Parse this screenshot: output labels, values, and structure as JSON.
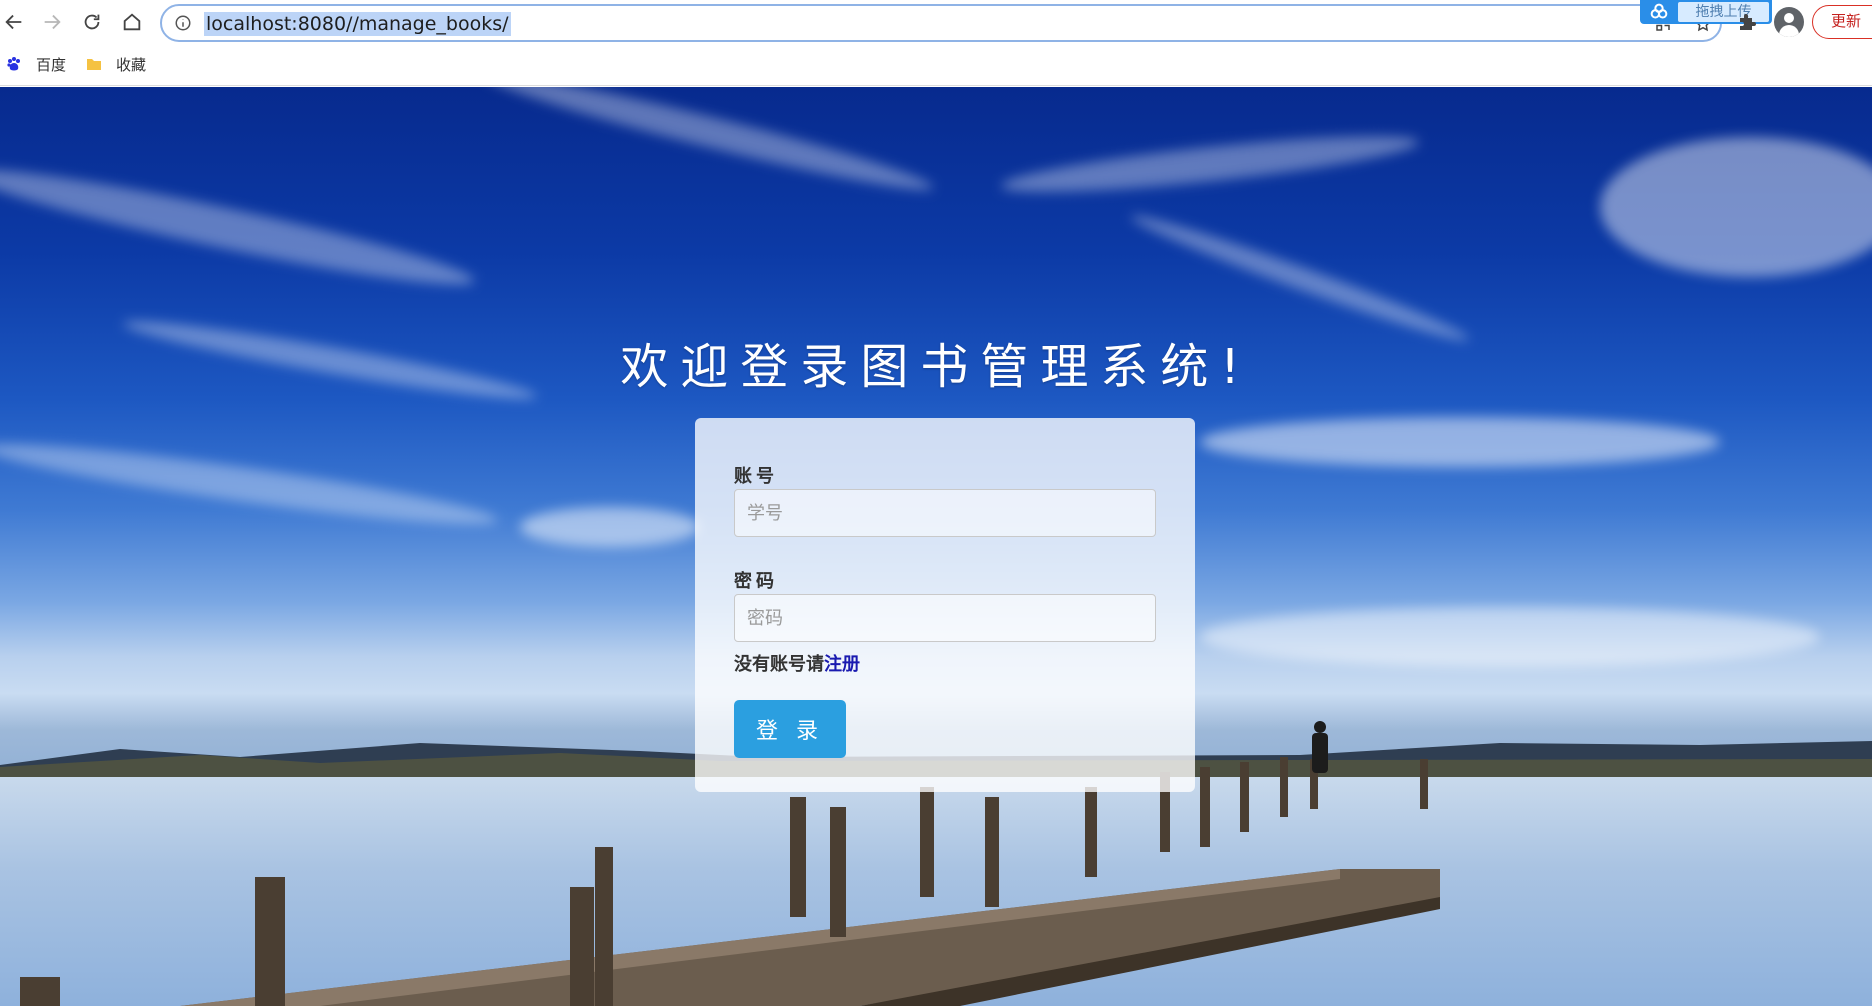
{
  "browser": {
    "url": "localhost:8080//manage_books/",
    "upload_badge_label": "拖拽上传",
    "update_label": "更新",
    "bookmarks": [
      {
        "label": "百度",
        "icon": "baidu-paw-icon"
      },
      {
        "label": "收藏",
        "icon": "folder-icon"
      }
    ]
  },
  "login": {
    "title": "欢迎登录图书管理系统!",
    "account_label": "账号",
    "account_placeholder": "学号",
    "password_label": "密码",
    "password_placeholder": "密码",
    "register_prefix": "没有账号请",
    "register_link": "注册",
    "submit_label": "登录"
  },
  "colors": {
    "button": "#2b9fe0",
    "register_link": "#1a1ab0",
    "sky_top": "#072a8e"
  }
}
